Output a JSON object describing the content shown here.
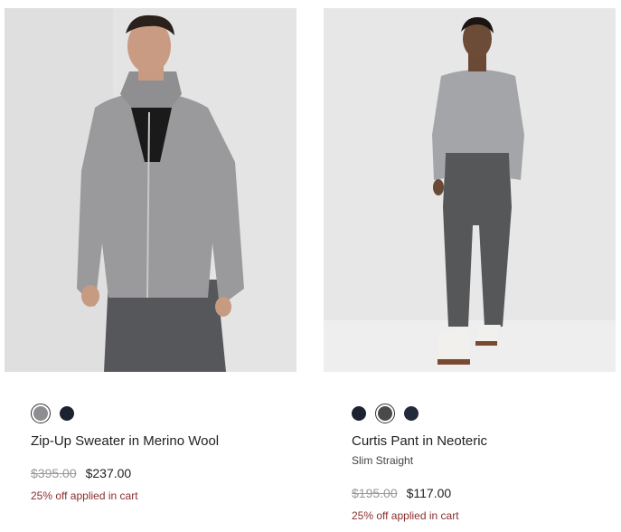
{
  "products": [
    {
      "name": "Zip-Up Sweater in Merino Wool",
      "subtitle": "",
      "original_price": "$395.00",
      "sale_price": "$237.00",
      "promo": "25% off applied in cart",
      "swatches": [
        {
          "color": "#8e8e92",
          "selected": true
        },
        {
          "color": "#1c2230",
          "selected": false
        }
      ],
      "photo_bg": "#e3e3e3"
    },
    {
      "name": "Curtis Pant in Neoteric",
      "subtitle": "Slim Straight",
      "original_price": "$195.00",
      "sale_price": "$117.00",
      "promo": "25% off applied in cart",
      "swatches": [
        {
          "color": "#1c2230",
          "selected": false
        },
        {
          "color": "#4a4a4a",
          "selected": true
        },
        {
          "color": "#232a3a",
          "selected": false
        }
      ],
      "photo_bg": "#e6e6e6"
    }
  ],
  "colors": {
    "promo": "#8a2e2e",
    "strike_price": "#999999"
  }
}
